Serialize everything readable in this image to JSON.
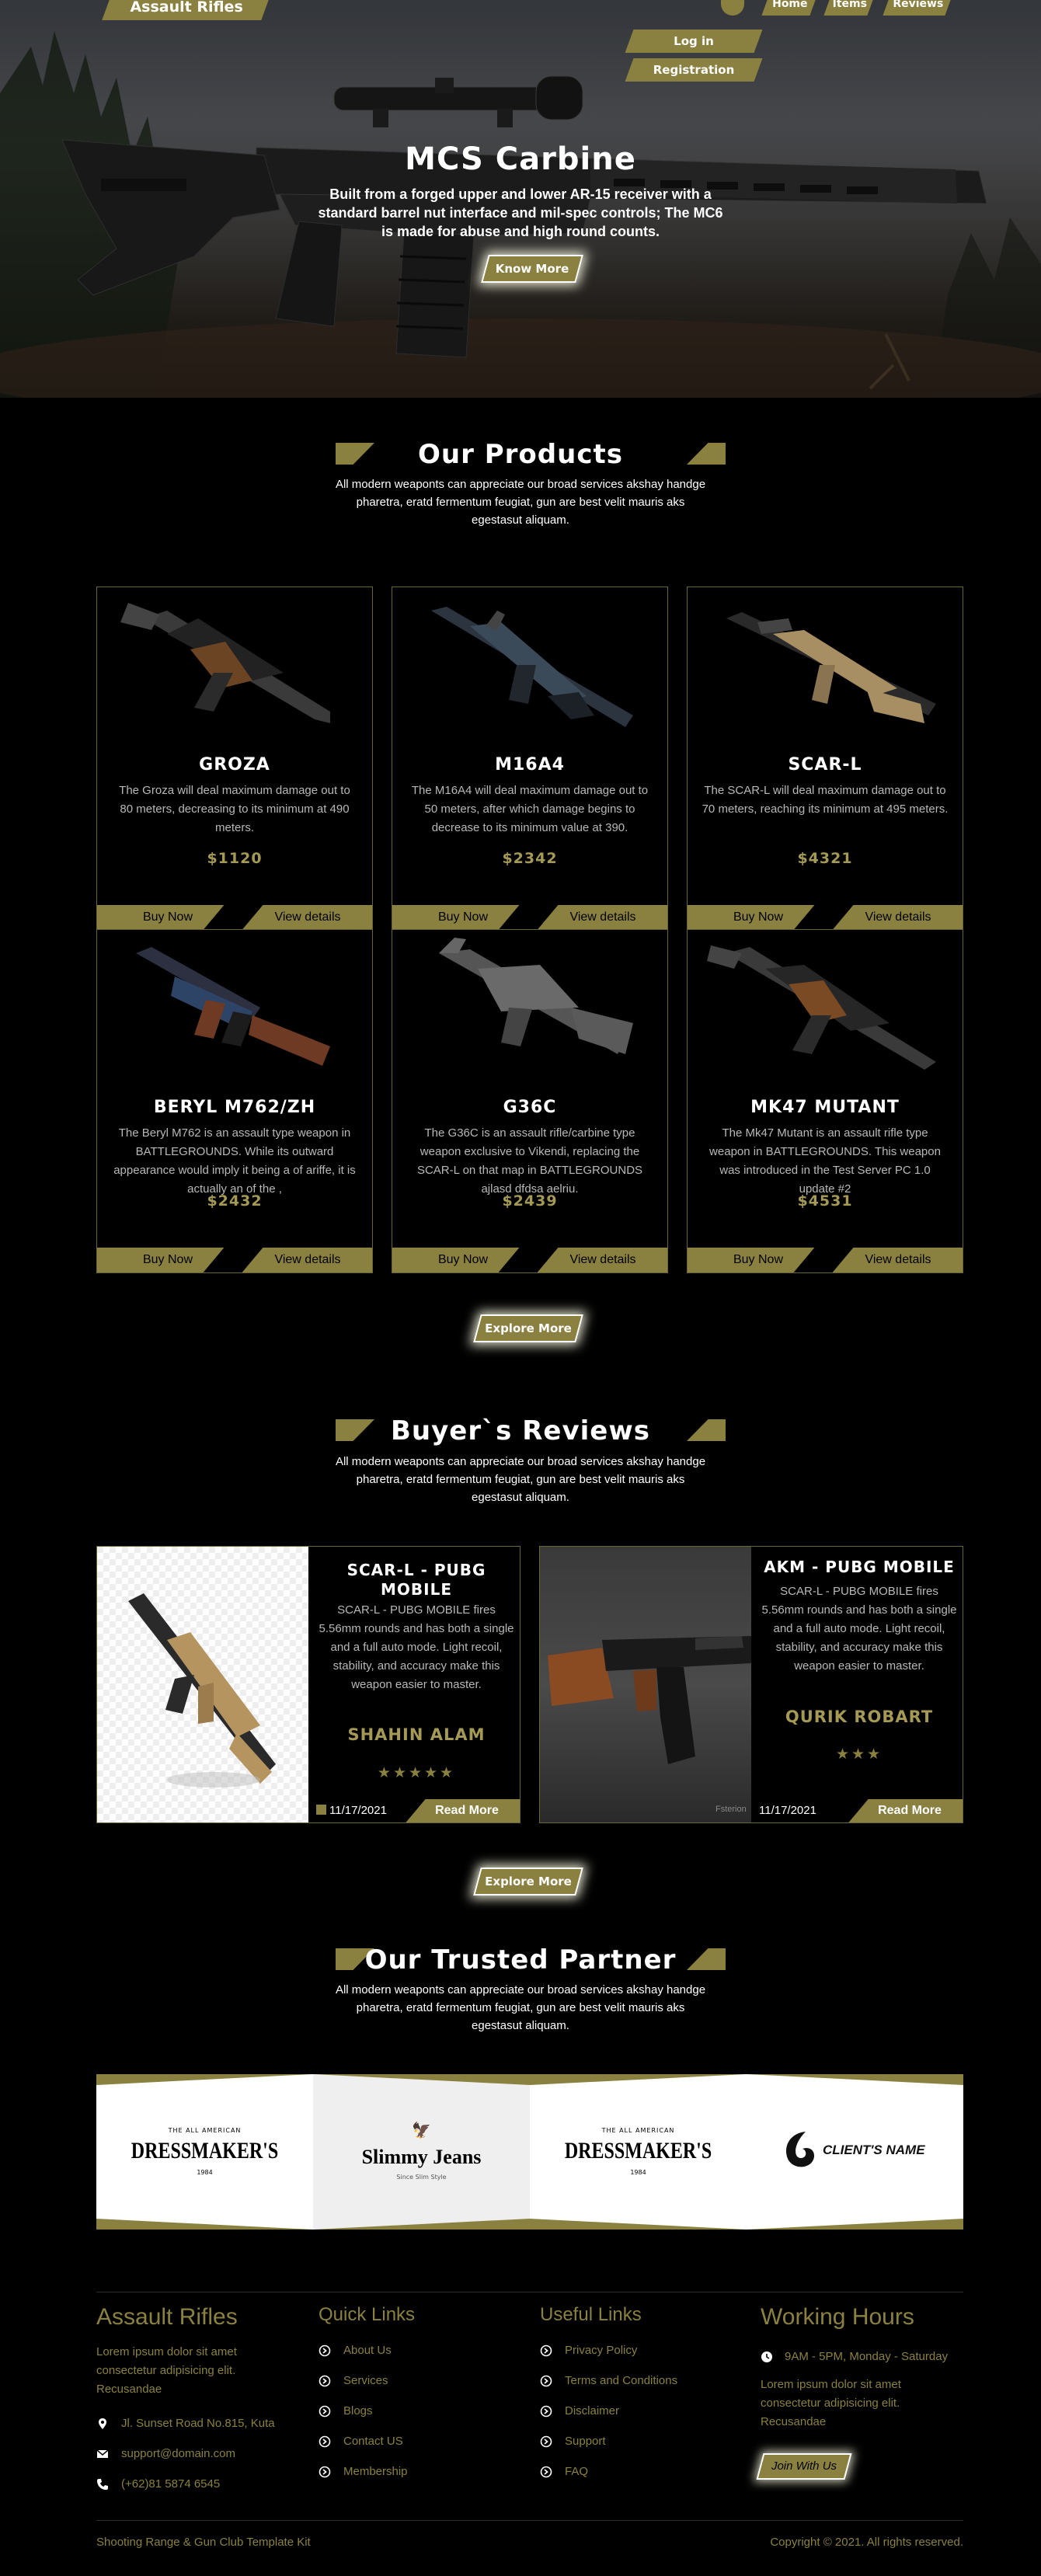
{
  "header": {
    "logo": "Assault Rifles",
    "nav": [
      "Home",
      "Items",
      "Reviews"
    ],
    "login": "Log in",
    "registration": "Registration"
  },
  "hero": {
    "title": "MCS Carbine",
    "text": "Built from a forged upper and lower AR-15 receiver with a standard barrel nut interface and mil-spec controls; The MC6 is made for abuse and high round counts.",
    "button": "Know More"
  },
  "products": {
    "title": "Our Products",
    "description": "All modern weaponts can appreciate our broad services akshay handge pharetra, eratd fermentum feugiat, gun are best velit mauris aks egestasut aliquam.",
    "items": [
      {
        "name": "GROZA",
        "desc": "The Groza will deal maximum damage out to 80 meters, decreasing to its minimum at 490 meters.",
        "price": "$1120",
        "buy": "Buy Now",
        "details": "View details"
      },
      {
        "name": "M16A4",
        "desc": "The M16A4 will deal maximum damage out to 50 meters, after which damage begins to decrease to its minimum value at 390.",
        "price": "$2342",
        "buy": "Buy Now",
        "details": "View details"
      },
      {
        "name": "SCAR-L",
        "desc": "The SCAR-L will deal maximum damage out to 70 meters, reaching its minimum at 495 meters.",
        "price": "$4321",
        "buy": "Buy Now",
        "details": "View details"
      },
      {
        "name": "BERYL M762/ZH",
        "desc": "The Beryl M762 is an assault type weapon in BATTLEGROUNDS. While its outward appearance would imply it being a of ariffe, it is actually an of the ,",
        "price": "$2432",
        "buy": "Buy Now",
        "details": "View details"
      },
      {
        "name": "G36C",
        "desc": "The G36C is an assault rifle/carbine type weapon exclusive to Vikendi, replacing the SCAR-L on that map in BATTLEGROUNDS ajlasd dfdsa aelriu.",
        "price": "$2439",
        "buy": "Buy Now",
        "details": "View details"
      },
      {
        "name": "MK47 MUTANT",
        "desc": "The Mk47 Mutant is an assault rifle type weapon in BATTLEGROUNDS. This weapon was introduced in the Test Server PC 1.0 update #2",
        "price": "$4531",
        "buy": "Buy Now",
        "details": "View details"
      }
    ],
    "explore": "Explore More"
  },
  "reviews": {
    "title": "Buyer`s Reviews",
    "description": "All modern weaponts can appreciate our broad services akshay handge pharetra, eratd fermentum feugiat, gun are best velit mauris aks egestasut aliquam.",
    "items": [
      {
        "title": "SCAR-L - PUBG MOBILE",
        "text": "SCAR-L - PUBG MOBILE fires 5.56mm rounds and has both a single and a full auto mode. Light recoil, stability, and accuracy make this weapon easier to master.",
        "author": "SHAHIN ALAM",
        "stars": "★★★★★",
        "date": "11/17/2021",
        "more": "Read More"
      },
      {
        "title": "AKM - PUBG MOBILE",
        "text": "SCAR-L - PUBG MOBILE fires 5.56mm rounds and has both a single and a full auto mode. Light recoil, stability, and accuracy make this weapon easier to master.",
        "author": "QURIK ROBART",
        "stars": "★★★",
        "date": "11/17/2021",
        "more": "Read More",
        "watermark": "Fsterion"
      }
    ],
    "explore": "Explore More"
  },
  "partners": {
    "title": "Our Trusted Partner",
    "description": "All modern weaponts can appreciate our broad services akshay handge pharetra, eratd fermentum feugiat, gun are best velit mauris aks egestasut aliquam.",
    "logos": [
      {
        "top": "THE ALL AMERICAN",
        "main": "DRESSMAKER'S",
        "sub": "1984"
      },
      {
        "main": "Slimmy Jeans",
        "sub": "Since Slim Style"
      },
      {
        "top": "THE ALL AMERICAN",
        "main": "DRESSMAKER'S",
        "sub": "1984"
      },
      {
        "main": "CLIENT'S NAME"
      }
    ]
  },
  "footer": {
    "brand": "Assault Rifles",
    "about": "Lorem ipsum dolor sit amet consectetur adipisicing elit. Recusandae",
    "address": "Jl. Sunset Road No.815, Kuta",
    "email": "support@domain.com",
    "phone": "(+62)81 5874 6545",
    "quick_title": "Quick Links",
    "quick_links": [
      "About Us",
      "Services",
      "Blogs",
      "Contact US",
      "Membership"
    ],
    "useful_title": "Useful Links",
    "useful_links": [
      "Privacy Policy",
      "Terms and Conditions",
      "Disclaimer",
      "Support",
      "FAQ"
    ],
    "hours_title": "Working Hours",
    "hours": "9AM - 5PM, Monday - Saturday",
    "hours_text": "Lorem ipsum dolor sit amet consectetur adipisicing elit. Recusandae",
    "join": "Join With Us",
    "kit": "Shooting Range & Gun Club Template Kit",
    "copyright": "Copyright © 2021. All rights reserved."
  },
  "colors": {
    "accent": "#8a8140",
    "text_muted": "#b8b8b8",
    "price": "#a59a55"
  }
}
